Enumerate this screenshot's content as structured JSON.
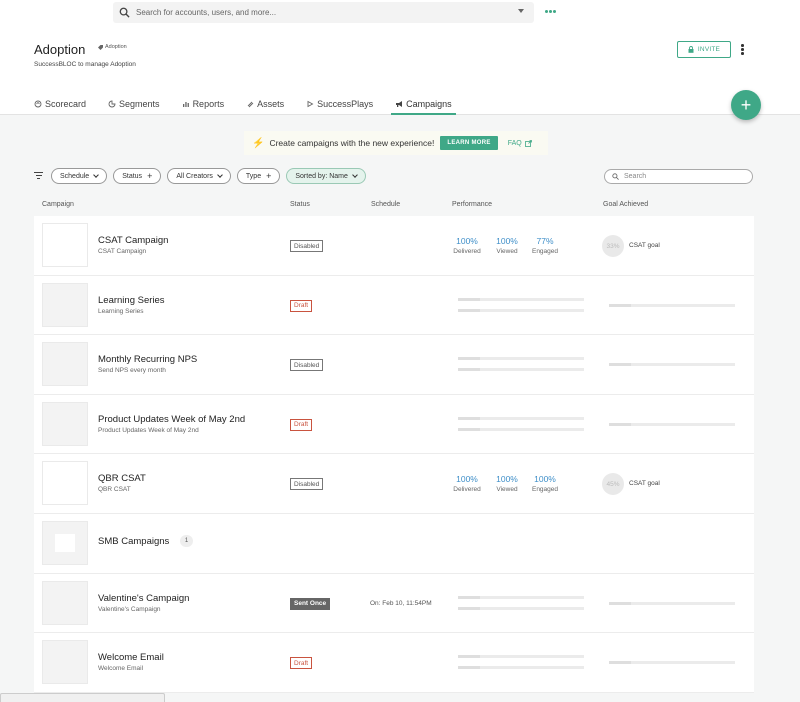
{
  "search_top": {
    "placeholder": "Search for accounts, users, and more..."
  },
  "header": {
    "title": "Adoption",
    "badge": "Adoption",
    "subtitle": "SuccessBLOC to manage Adoption",
    "invite_label": "INVITE"
  },
  "tabs": [
    {
      "label": "Scorecard",
      "icon": "scorecard-icon"
    },
    {
      "label": "Segments",
      "icon": "segments-icon"
    },
    {
      "label": "Reports",
      "icon": "reports-icon"
    },
    {
      "label": "Assets",
      "icon": "assets-icon"
    },
    {
      "label": "SuccessPlays",
      "icon": "play-icon"
    },
    {
      "label": "Campaigns",
      "icon": "megaphone-icon"
    }
  ],
  "fab": {
    "label": "+"
  },
  "banner": {
    "text": "Create campaigns with the new experience!",
    "button": "LEARN MORE",
    "faq": "FAQ"
  },
  "filters": {
    "schedule": "Schedule",
    "status": "Status",
    "creators": "All Creators",
    "type": "Type",
    "sorted": "Sorted by: Name",
    "search_placeholder": "Search"
  },
  "columns": {
    "campaign": "Campaign",
    "status": "Status",
    "schedule": "Schedule",
    "performance": "Performance",
    "goal": "Goal Achieved"
  },
  "rows": [
    {
      "name": "CSAT Campaign",
      "sub": "CSAT Campaign",
      "status": "Disabled",
      "delivered": "100%",
      "viewed": "100%",
      "engaged": "77%",
      "goal_pct": "33%",
      "goal": "CSAT goal"
    },
    {
      "name": "Learning Series",
      "sub": "Learning Series",
      "status": "Draft"
    },
    {
      "name": "Monthly Recurring NPS",
      "sub": "Send NPS every month",
      "status": "Disabled"
    },
    {
      "name": "Product Updates Week of May 2nd",
      "sub": "Product Updates Week of May 2nd",
      "status": "Draft"
    },
    {
      "name": "QBR CSAT",
      "sub": "QBR CSAT",
      "status": "Disabled",
      "delivered": "100%",
      "viewed": "100%",
      "engaged": "100%",
      "goal_pct": "45%",
      "goal": "CSAT goal"
    },
    {
      "name": "SMB Campaigns",
      "count": "1"
    },
    {
      "name": "Valentine's Campaign",
      "sub": "Valentine's Campaign",
      "status": "Sent Once",
      "schedule": "On: Feb 10, 11:54PM"
    },
    {
      "name": "Welcome Email",
      "sub": "Welcome Email",
      "status": "Draft"
    }
  ],
  "perf_labels": {
    "delivered": "Delivered",
    "viewed": "Viewed",
    "engaged": "Engaged"
  },
  "colors": {
    "accent": "#3fa887",
    "perf_value": "#3f8fc9",
    "draft": "#c9533f"
  }
}
